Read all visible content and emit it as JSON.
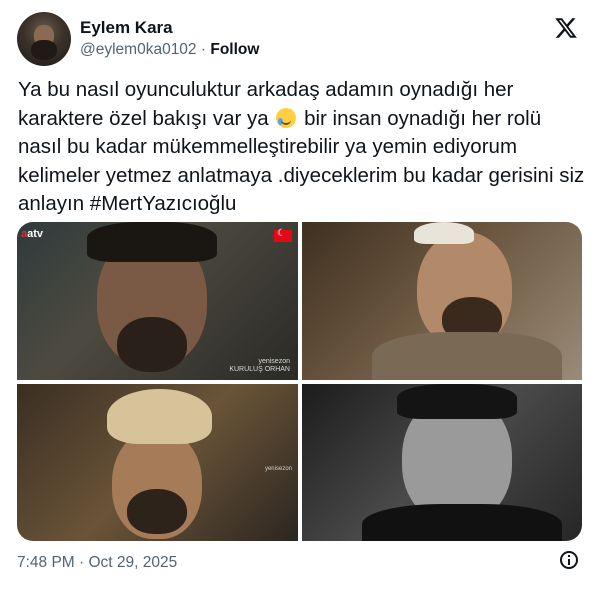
{
  "author": {
    "name": "Eylem Kara",
    "handle": "@eylem0ka0102",
    "separator": "·",
    "follow_label": "Follow"
  },
  "platform": {
    "logo_icon": "x-logo-icon"
  },
  "tweet": {
    "text_part1": "Ya bu nasıl oyunculuktur arkadaş adamın oynadığı her karaktere özel bakışı var ya",
    "emoji_icon": "smiling-face-with-tear-icon",
    "text_part2": "bir insan oynadığı her rolü nasıl bu kadar mükemmelleştirebilir ya yemin ediyorum kelimeler yetmez anlatmaya .diyeceklerim bu kadar gerisini siz anlayın #MertYazıcıoğlu"
  },
  "media": {
    "images": [
      {
        "name": "actor-photo-warrior",
        "overlay_logo": "atv",
        "watermark_line1": "yenisezon",
        "watermark_line2": "KURULUŞ ORHAN"
      },
      {
        "name": "actor-photo-smiling"
      },
      {
        "name": "actor-photo-turban",
        "watermark": "yenisezon"
      },
      {
        "name": "actor-photo-black-white"
      }
    ]
  },
  "timestamp": "7:48 PM · Oct 29, 2025",
  "info_icon": "info-icon"
}
